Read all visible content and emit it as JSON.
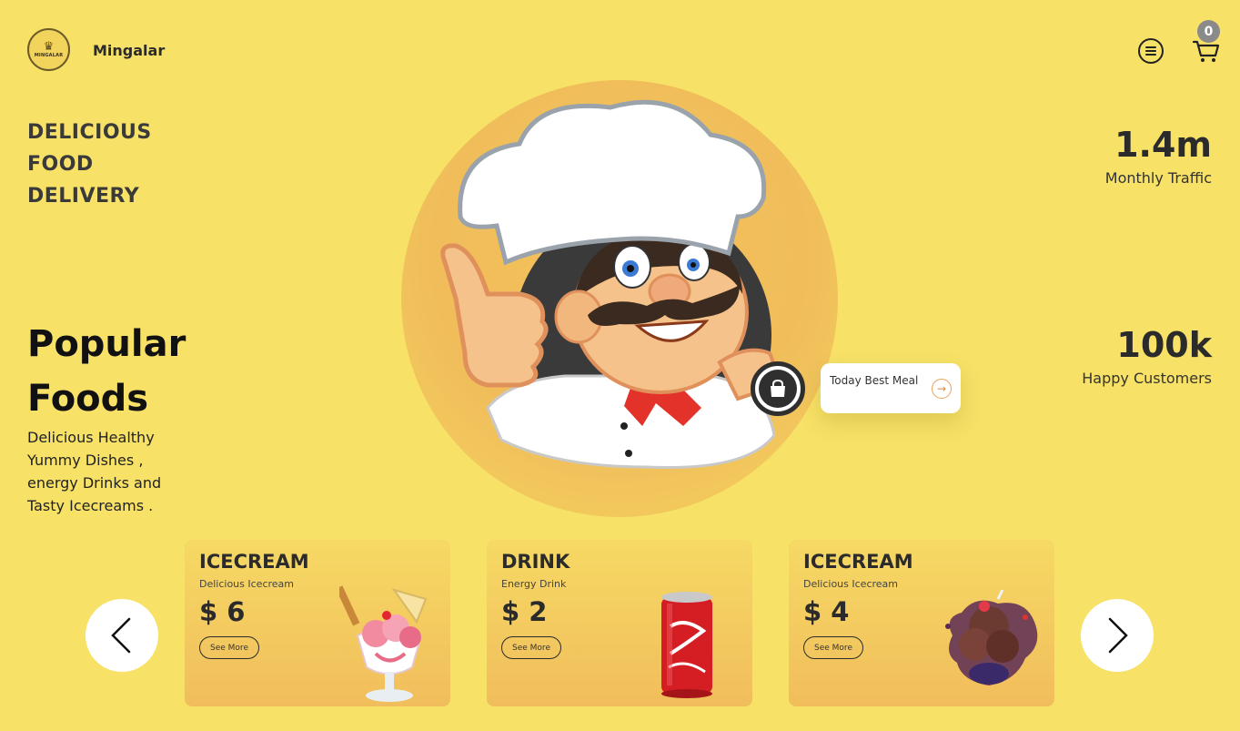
{
  "header": {
    "logo_text": "MINGALAR",
    "brand": "Mingalar",
    "cart_count": "0"
  },
  "hero": {
    "tagline": [
      "DELICIOUS",
      "FOOD",
      "DELIVERY"
    ],
    "popular_title_line1": "Popular",
    "popular_title_line2": "Foods",
    "popular_desc": "Delicious Healthy Yummy Dishes , energy Drinks and Tasty Icecreams .",
    "best_meal_label": "Today Best Meal"
  },
  "stats": [
    {
      "value": "1.4m",
      "label": "Monthly Traffic"
    },
    {
      "value": "100k",
      "label": "Happy Customers"
    }
  ],
  "cards": [
    {
      "category": "ICECREAM",
      "subtitle": "Delicious Icecream",
      "price": "$ 6",
      "button": "See More"
    },
    {
      "category": "DRINK",
      "subtitle": "Energy Drink",
      "price": "$ 2",
      "button": "See More"
    },
    {
      "category": "ICECREAM",
      "subtitle": "Delicious Icecream",
      "price": "$ 4",
      "button": "See More"
    }
  ],
  "colors": {
    "background": "#f7e166",
    "card_gradient_top": "#f6d964",
    "card_gradient_bottom": "#f1bd5c",
    "hero_circle": "#f0bd5a",
    "text_dark": "#2b2b2b"
  },
  "icons": {
    "menu": "menu-icon",
    "cart": "cart-icon",
    "bag": "shopping-bag-icon",
    "arrow": "arrow-right-icon",
    "prev": "chevron-left-icon",
    "next": "chevron-right-icon"
  }
}
